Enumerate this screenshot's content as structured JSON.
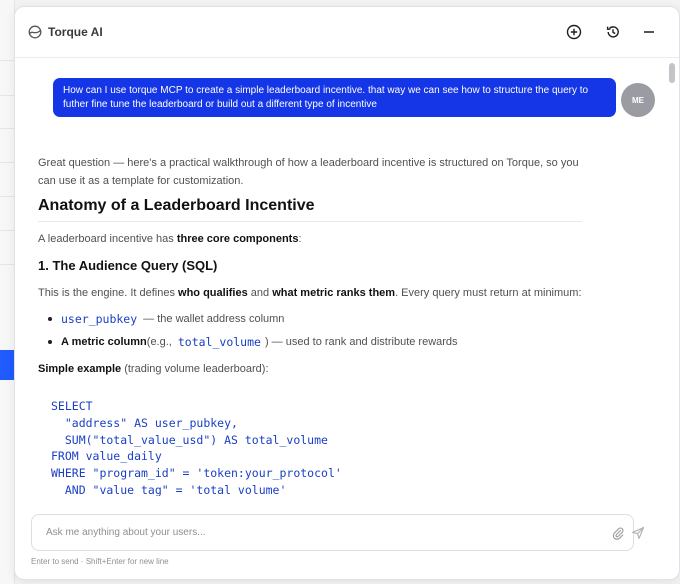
{
  "app": {
    "title": "Torque AI"
  },
  "header": {
    "icons": [
      "torque-logo-icon",
      "new-chat-icon",
      "history-icon",
      "minimize-icon"
    ]
  },
  "user": {
    "avatar_initials": "ME",
    "message": "How can I use torque MCP to create a simple leaderboard incentive. that way we can see how to structure the query to futher fine tune the leaderboard or build out a different type of incentive"
  },
  "assistant": {
    "intro": "Great question — here's a practical walkthrough of how a leaderboard incentive is structured on Torque, so you can use it as a template for customization.",
    "heading": "Anatomy of a Leaderboard Incentive",
    "components": {
      "pre": "A leaderboard incentive has ",
      "bold": "three core components",
      "post": ":"
    },
    "section_heading": "1. The Audience Query (SQL)",
    "engine": {
      "pre": "This is the engine. It defines ",
      "bold1": "who qualifies",
      "mid": " and ",
      "bold2": "what metric ranks them",
      "post": ". Every query must return at minimum:"
    },
    "bullets": [
      {
        "code": "user_pubkey",
        "text": " — the wallet address column"
      },
      {
        "bold": "A metric column",
        "pre": " (e.g., ",
        "code": "total_volume",
        "text": " ) — used to rank and distribute rewards"
      }
    ],
    "example": {
      "bold": "Simple example",
      "text": " (trading volume leaderboard):"
    },
    "code_lines": [
      "SELECT",
      "  \"address\" AS user_pubkey,",
      "  SUM(\"total_value_usd\") AS total_volume",
      "FROM value_daily",
      "WHERE \"program_id\" = 'token:your_protocol'",
      "  AND \"value_tag\" = 'total_volume'"
    ]
  },
  "composer": {
    "placeholder": "Ask me anything about your users...",
    "hint": "Enter to send · Shift+Enter for new line",
    "icons": [
      "attach-icon",
      "send-icon"
    ]
  }
}
